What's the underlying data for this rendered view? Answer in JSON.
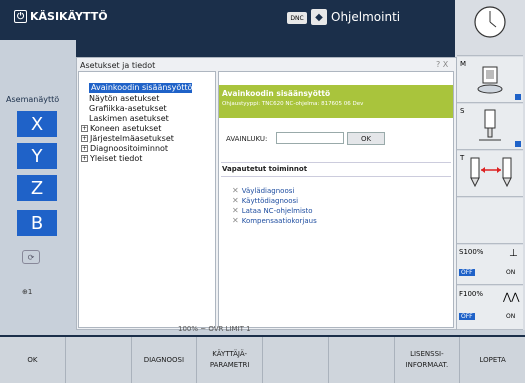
{
  "topbar": {
    "mode_left": "KÄSIKÄYTTÖ",
    "dnc_label": "DNC",
    "mode_right": "Ohjelmointi"
  },
  "background": {
    "position_title": "Asemanäyttö",
    "axes": [
      "X",
      "Y",
      "Z",
      "B"
    ]
  },
  "dialog": {
    "title": "Asetukset ja tiedot",
    "controls": "? X",
    "tree": [
      {
        "label": "Avainkoodin sisäänsyöttö",
        "selected": true,
        "expandable": false
      },
      {
        "label": "Näytön asetukset",
        "selected": false,
        "expandable": false
      },
      {
        "label": "Grafiikka-asetukset",
        "selected": false,
        "expandable": false
      },
      {
        "label": "Laskimen asetukset",
        "selected": false,
        "expandable": false
      },
      {
        "label": "Koneen asetukset",
        "selected": false,
        "expandable": true
      },
      {
        "label": "Järjestelmäasetukset",
        "selected": false,
        "expandable": true
      },
      {
        "label": "Diagnoositoiminnot",
        "selected": false,
        "expandable": true
      },
      {
        "label": "Yleiset tiedot",
        "selected": false,
        "expandable": true
      }
    ],
    "panel": {
      "title": "Avainkoodin sisäänsyöttö",
      "subtitle": "Ohjaustyyppi: TNC620      NC-ohjelma: 817605 06 Dev",
      "key_label": "AVAINLUKU:",
      "key_value": "",
      "ok_label": "OK",
      "freed_title": "Vapautetut toiminnot",
      "functions": [
        "Väylädiagnoosi",
        "Käyttödiagnoosi",
        "Lataa NC-ohjelmisto",
        "Kompensaatiokorjaus"
      ]
    }
  },
  "status_text": "100% ~ OVR        LIMIT 1",
  "right_col": {
    "labels": [
      "M",
      "S",
      "T"
    ],
    "s_override": "S100%",
    "f_override": "F100%",
    "off": "OFF",
    "on": "ON"
  },
  "softkeys": [
    "OK",
    "",
    "DIAGNOOSI",
    "KÄYTTÄJÄ-\nPARAMETRI",
    "",
    "",
    "LISENSSI-\nINFORMAAT.",
    "LOPETA"
  ],
  "colors": {
    "header_bg": "#1b2f4a",
    "accent_blue": "#1f62c8",
    "green_header": "#a9c43c"
  }
}
